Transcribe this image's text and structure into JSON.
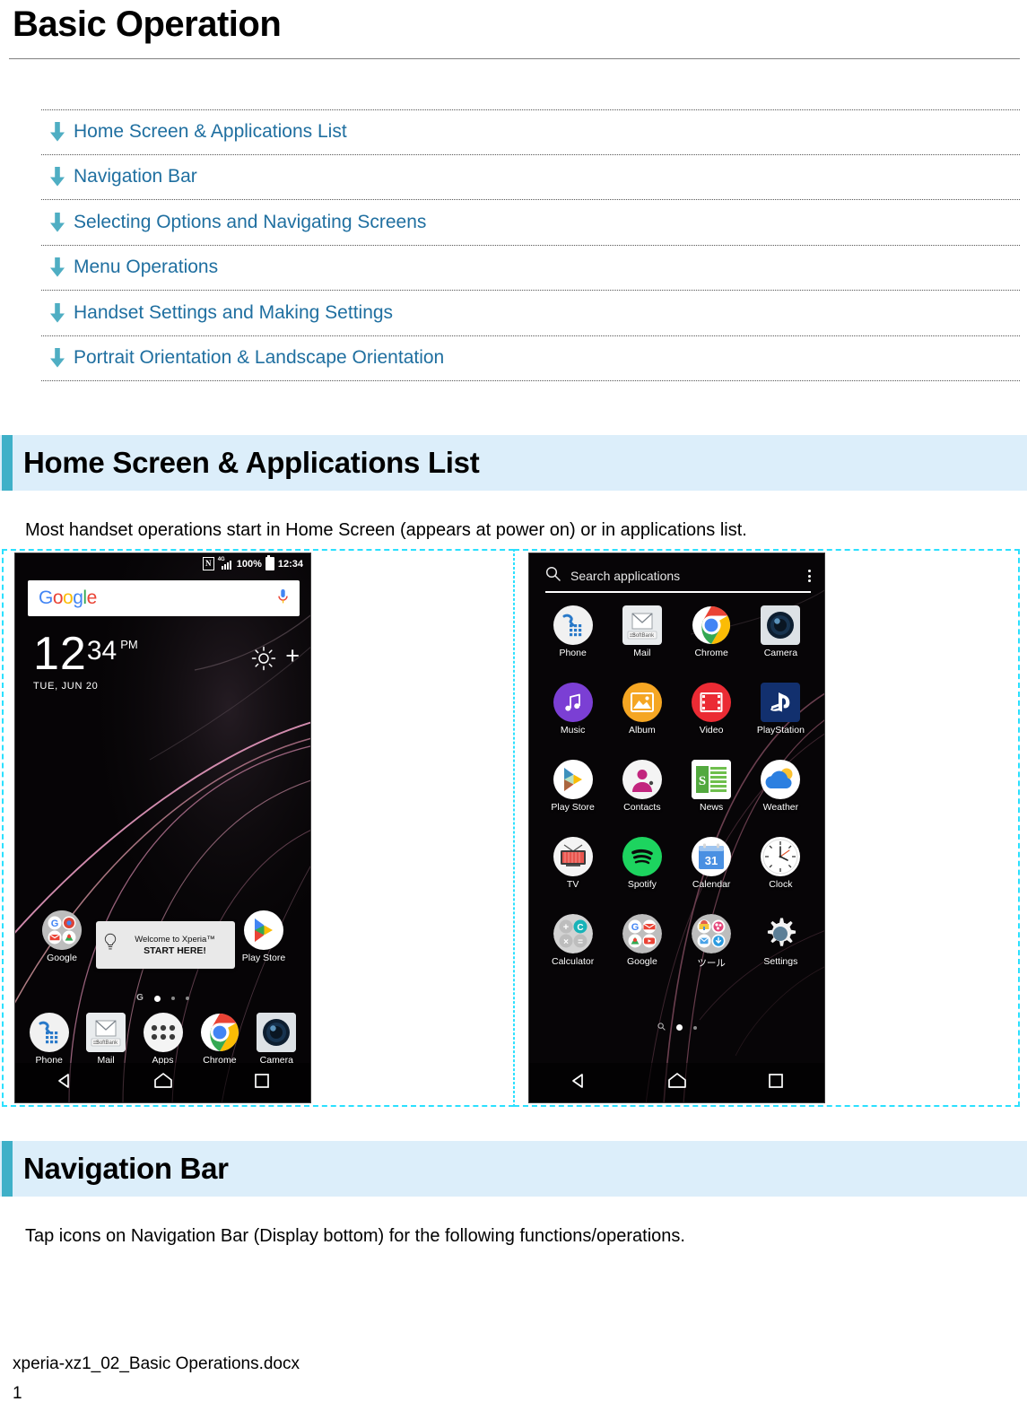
{
  "document": {
    "title": "Basic Operation",
    "file_name": "xperia-xz1_02_Basic Operations.docx",
    "page_number": "1"
  },
  "toc": {
    "items": [
      {
        "label": "Home Screen & Applications List",
        "icon": "down-arrow-icon"
      },
      {
        "label": "Navigation Bar",
        "icon": "down-arrow-icon"
      },
      {
        "label": "Selecting Options and Navigating Screens",
        "icon": "down-arrow-icon"
      },
      {
        "label": "Menu Operations",
        "icon": "down-arrow-icon"
      },
      {
        "label": "Handset Settings and Making Settings",
        "icon": "down-arrow-icon"
      },
      {
        "label": "Portrait Orientation & Landscape Orientation",
        "icon": "down-arrow-icon"
      }
    ]
  },
  "sections": [
    {
      "heading": "Home Screen & Applications List",
      "body": "Most handset operations start in Home Screen (appears at power on) or in applications list."
    },
    {
      "heading": "Navigation Bar",
      "body": "Tap icons on Navigation Bar (Display bottom) for the following functions/operations."
    }
  ],
  "home_screen": {
    "status_bar": {
      "nfc": "N",
      "network": "4G",
      "battery_percent": "100%",
      "time": "12:34"
    },
    "search_widget": {
      "brand": "Google",
      "mic_icon": "microphone-icon"
    },
    "clock_widget": {
      "hour": "12",
      "minute": "34",
      "ampm": "PM",
      "date": "TUE, JUN 20",
      "weather_icon": "sun-icon",
      "add_icon": "plus-icon"
    },
    "welcome_card": {
      "line1": "Welcome to Xperia™",
      "line2": "START HERE!",
      "icon": "lightbulb-icon"
    },
    "row_top": [
      {
        "label": "Google",
        "icon": "google-folder-icon"
      },
      {
        "label": "Play Store",
        "icon": "play-store-icon"
      }
    ],
    "page_dots": {
      "count": 4,
      "active_index": 1,
      "leading_icon": "google-g-icon"
    },
    "dock": [
      {
        "label": "Phone",
        "icon": "phone-icon"
      },
      {
        "label": "Mail",
        "icon": "mail-softbank-icon"
      },
      {
        "label": "Apps",
        "icon": "apps-grid-icon"
      },
      {
        "label": "Chrome",
        "icon": "chrome-icon"
      },
      {
        "label": "Camera",
        "icon": "camera-icon"
      }
    ],
    "nav_bar": [
      {
        "name": "back",
        "icon": "triangle-back-icon"
      },
      {
        "name": "home",
        "icon": "home-icon"
      },
      {
        "name": "recents",
        "icon": "square-recents-icon"
      }
    ]
  },
  "apps_list": {
    "search": {
      "placeholder": "Search applications",
      "icon": "search-icon",
      "menu_icon": "kebab-menu-icon"
    },
    "apps": [
      {
        "label": "Phone",
        "icon": "phone-icon"
      },
      {
        "label": "Mail",
        "icon": "mail-softbank-icon"
      },
      {
        "label": "Chrome",
        "icon": "chrome-icon"
      },
      {
        "label": "Camera",
        "icon": "camera-icon"
      },
      {
        "label": "Music",
        "icon": "music-note-icon"
      },
      {
        "label": "Album",
        "icon": "album-photo-icon"
      },
      {
        "label": "Video",
        "icon": "video-film-icon"
      },
      {
        "label": "PlayStation",
        "icon": "playstation-icon"
      },
      {
        "label": "Play Store",
        "icon": "play-store-icon"
      },
      {
        "label": "Contacts",
        "icon": "contacts-person-icon"
      },
      {
        "label": "News",
        "icon": "news-icon"
      },
      {
        "label": "Weather",
        "icon": "weather-sun-cloud-icon"
      },
      {
        "label": "TV",
        "icon": "tv-icon"
      },
      {
        "label": "Spotify",
        "icon": "spotify-icon"
      },
      {
        "label": "Calendar",
        "icon": "calendar-31-icon"
      },
      {
        "label": "Clock",
        "icon": "analog-clock-icon"
      },
      {
        "label": "Calculator",
        "icon": "calculator-folder-icon"
      },
      {
        "label": "Google",
        "icon": "google-folder-icon"
      },
      {
        "label": "ツール",
        "icon": "tools-folder-icon"
      },
      {
        "label": "Settings",
        "icon": "gear-icon"
      }
    ],
    "page_dots": {
      "count": 3,
      "active_index": 1,
      "leading_icon": "search-small-icon"
    },
    "nav_bar": [
      {
        "name": "back",
        "icon": "triangle-back-icon"
      },
      {
        "name": "home",
        "icon": "home-icon"
      },
      {
        "name": "recents",
        "icon": "square-recents-icon"
      }
    ]
  },
  "colors": {
    "link": "#1F6FA0",
    "accent_bar": "#3FB0C8",
    "band_bg": "#DCEEFA",
    "cell_border": "#2BE0FF"
  }
}
